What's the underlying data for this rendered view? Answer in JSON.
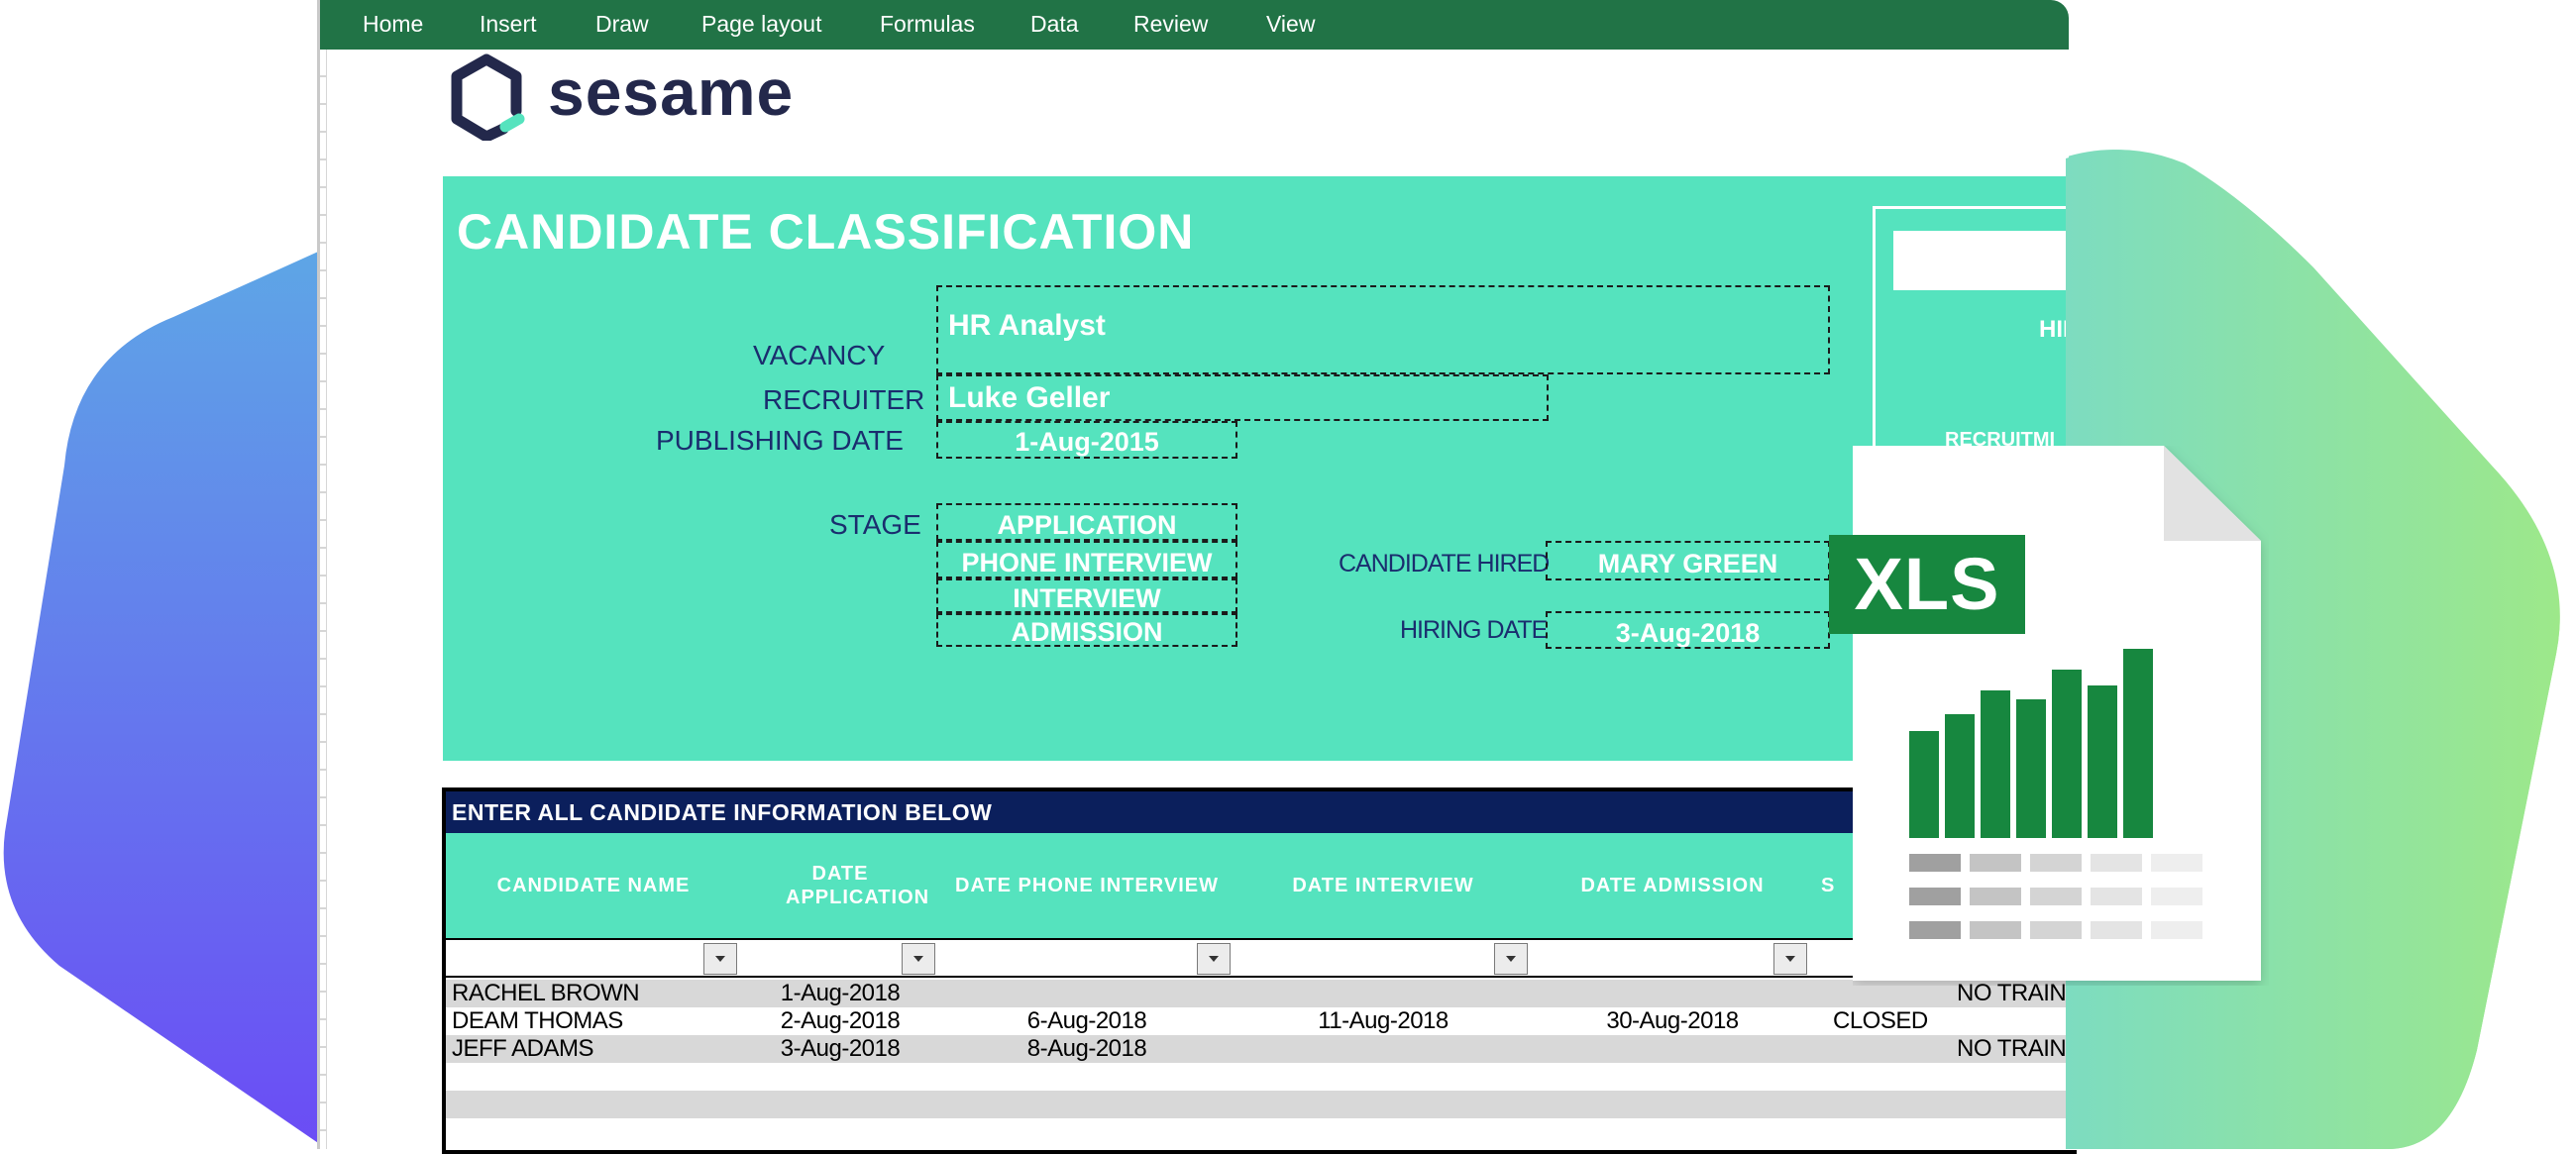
{
  "ribbon": {
    "tabs": [
      "Home",
      "Insert",
      "Draw",
      "Page layout",
      "Formulas",
      "Data",
      "Review",
      "View"
    ]
  },
  "logo": {
    "text": "sesame"
  },
  "form": {
    "title": "CANDIDATE CLASSIFICATION",
    "vacancy_label": "VACANCY",
    "vacancy_value": "HR Analyst",
    "recruiter_label": "RECRUITER",
    "recruiter_value": "Luke Geller",
    "publishing_date_label": "PUBLISHING DATE",
    "publishing_date_value": "1-Aug-2015",
    "stage_label": "STAGE",
    "stages": [
      "APPLICATION",
      "PHONE INTERVIEW",
      "INTERVIEW",
      "ADMISSION"
    ],
    "candidate_hired_label": "CANDIDATE HIRED",
    "candidate_hired_value": "MARY GREEN",
    "hiring_date_label": "HIRING DATE",
    "hiring_date_value": "3-Aug-2018"
  },
  "summary_box": {
    "partial_text_1": "HII",
    "partial_text_2": "RECRUITMI"
  },
  "table": {
    "header_title": "ENTER ALL CANDIDATE INFORMATION BELOW",
    "columns": [
      "CANDIDATE NAME",
      "DATE APPLICATION",
      "DATE PHONE INTERVIEW",
      "DATE INTERVIEW",
      "DATE ADMISSION",
      "S"
    ],
    "rows": [
      {
        "name": "RACHEL BROWN",
        "date_application": "1-Aug-2018",
        "date_phone": "",
        "date_interview": "",
        "date_admission": "",
        "status": "",
        "extra": "NO TRAIN"
      },
      {
        "name": "DEAM THOMAS",
        "date_application": "2-Aug-2018",
        "date_phone": "6-Aug-2018",
        "date_interview": "11-Aug-2018",
        "date_admission": "30-Aug-2018",
        "status": "CLOSED",
        "extra": ""
      },
      {
        "name": "JEFF ADAMS",
        "date_application": "3-Aug-2018",
        "date_phone": "8-Aug-2018",
        "date_interview": "",
        "date_admission": "",
        "status": "",
        "extra": "NO TRAIN"
      }
    ]
  },
  "file_icon": {
    "badge": "XLS"
  },
  "colors": {
    "ribbon": "#217346",
    "panel": "#55e3be",
    "table_header": "#0b1f5c",
    "label_text": "#1a2d6e",
    "xls_green": "#17873f"
  }
}
